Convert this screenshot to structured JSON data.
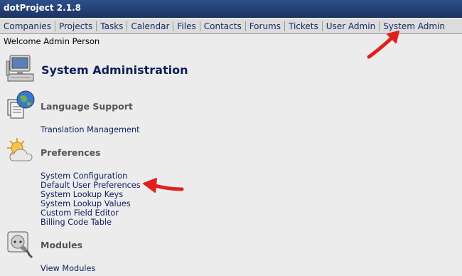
{
  "app": {
    "title": "dotProject 2.1.8"
  },
  "nav": [
    {
      "label": "Companies"
    },
    {
      "label": "Projects"
    },
    {
      "label": "Tasks"
    },
    {
      "label": "Calendar"
    },
    {
      "label": "Files"
    },
    {
      "label": "Contacts"
    },
    {
      "label": "Forums"
    },
    {
      "label": "Tickets"
    },
    {
      "label": "User Admin"
    },
    {
      "label": "System Admin"
    }
  ],
  "welcome": "Welcome Admin Person",
  "page_title": "System Administration",
  "sections": {
    "language": {
      "title": "Language Support",
      "icon": "globe-documents-icon",
      "links": [
        "Translation Management"
      ]
    },
    "preferences": {
      "title": "Preferences",
      "icon": "sun-cloud-icon",
      "links": [
        "System Configuration",
        "Default User Preferences",
        "System Lookup Keys",
        "System Lookup Values",
        "Custom Field Editor",
        "Billing Code Table"
      ]
    },
    "modules": {
      "title": "Modules",
      "icon": "power-socket-icon",
      "links": [
        "View Modules"
      ]
    }
  },
  "annotation_color": "#e0201c"
}
